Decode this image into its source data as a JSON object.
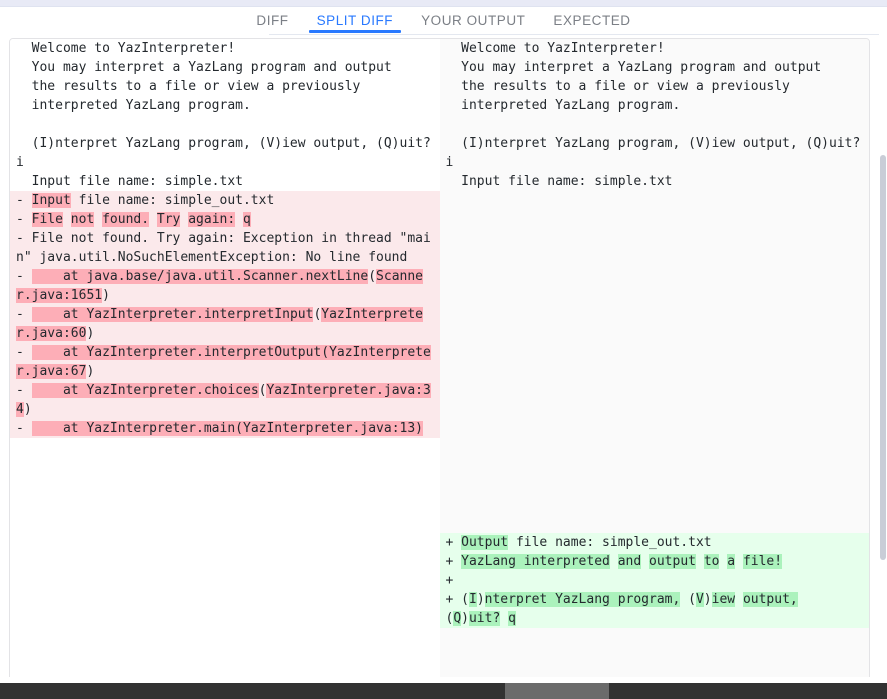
{
  "tabs": [
    {
      "label": "DIFF",
      "active": false
    },
    {
      "label": "SPLIT DIFF",
      "active": true
    },
    {
      "label": "YOUR OUTPUT",
      "active": false
    },
    {
      "label": "EXPECTED",
      "active": false
    }
  ],
  "colors": {
    "accent": "#2979ff",
    "tab_inactive": "#7b7f86",
    "del_line_bg": "#fbe9eb",
    "del_word_bg": "#fdaeb7",
    "add_line_bg": "#e6ffec",
    "add_word_bg": "#abf2bc",
    "text": "#24292e",
    "right_pane_bg": "#fafafa",
    "scrollbar_track": "#323232",
    "scrollbar_thumb": "#6b6b6b"
  },
  "left_pane": {
    "name": "your-output",
    "lines": [
      {
        "type": "ctx",
        "sign": "  ",
        "parts": [
          {
            "t": "Welcome to YazInterpreter!",
            "hl": false
          }
        ]
      },
      {
        "type": "ctx",
        "sign": "  ",
        "parts": [
          {
            "t": "You may interpret a YazLang program and output",
            "hl": false
          }
        ]
      },
      {
        "type": "ctx",
        "sign": "  ",
        "parts": [
          {
            "t": "the results to a file or view a previously",
            "hl": false
          }
        ]
      },
      {
        "type": "ctx",
        "sign": "  ",
        "parts": [
          {
            "t": "interpreted YazLang program.",
            "hl": false
          }
        ]
      },
      {
        "type": "ctx",
        "sign": "  ",
        "parts": [
          {
            "t": "",
            "hl": false
          }
        ]
      },
      {
        "type": "ctx",
        "sign": "  ",
        "parts": [
          {
            "t": "(I)nterpret YazLang program, (V)iew output, (Q)uit? i",
            "hl": false
          }
        ]
      },
      {
        "type": "ctx",
        "sign": "  ",
        "parts": [
          {
            "t": "Input file name: simple.txt",
            "hl": false
          }
        ]
      },
      {
        "type": "del",
        "sign": "- ",
        "parts": [
          {
            "t": "Input",
            "hl": true
          },
          {
            "t": " file name: simple_out.txt",
            "hl": false
          }
        ]
      },
      {
        "type": "del",
        "sign": "- ",
        "parts": [
          {
            "t": "File",
            "hl": true
          },
          {
            "t": " ",
            "hl": false
          },
          {
            "t": "not",
            "hl": true
          },
          {
            "t": " ",
            "hl": false
          },
          {
            "t": "found.",
            "hl": true
          },
          {
            "t": " ",
            "hl": false
          },
          {
            "t": "Try",
            "hl": true
          },
          {
            "t": " ",
            "hl": false
          },
          {
            "t": "again:",
            "hl": true
          },
          {
            "t": " ",
            "hl": false
          },
          {
            "t": "q",
            "hl": true
          }
        ]
      },
      {
        "type": "del",
        "sign": "- ",
        "parts": [
          {
            "t": "File not found. Try again: Exception in thread \"main\" java.util.NoSuchElementException: No line found",
            "hl": false
          }
        ]
      },
      {
        "type": "del",
        "sign": "- ",
        "parts": [
          {
            "t": "    at ",
            "hl": true
          },
          {
            "t": "java.base/java.util.Scanner.nextLine",
            "hl": true
          },
          {
            "t": "(",
            "hl": false
          },
          {
            "t": "Scanner.java:1651",
            "hl": true
          },
          {
            "t": ")",
            "hl": false
          }
        ]
      },
      {
        "type": "del",
        "sign": "- ",
        "parts": [
          {
            "t": "    at ",
            "hl": true
          },
          {
            "t": "YazInterpreter.interpretInput",
            "hl": true
          },
          {
            "t": "(",
            "hl": false
          },
          {
            "t": "YazInterpreter.java:60",
            "hl": true
          },
          {
            "t": ")",
            "hl": false
          }
        ]
      },
      {
        "type": "del",
        "sign": "- ",
        "parts": [
          {
            "t": "    at ",
            "hl": true
          },
          {
            "t": "YazInterpreter.interpretOutput(YazInterpreter.java:67",
            "hl": true
          },
          {
            "t": ")",
            "hl": false
          }
        ]
      },
      {
        "type": "del",
        "sign": "- ",
        "parts": [
          {
            "t": "    at ",
            "hl": true
          },
          {
            "t": "YazInterpreter.choices",
            "hl": true
          },
          {
            "t": "(",
            "hl": false
          },
          {
            "t": "YazInterpreter.java:34",
            "hl": true
          },
          {
            "t": ")",
            "hl": false
          }
        ]
      },
      {
        "type": "del",
        "sign": "- ",
        "parts": [
          {
            "t": "    at ",
            "hl": true
          },
          {
            "t": "YazInterpreter.main(YazInterpreter.java:13)",
            "hl": true
          }
        ]
      }
    ]
  },
  "right_pane": {
    "name": "expected-output",
    "lines": [
      {
        "type": "ctx",
        "sign": "  ",
        "parts": [
          {
            "t": "Welcome to YazInterpreter!",
            "hl": false
          }
        ]
      },
      {
        "type": "ctx",
        "sign": "  ",
        "parts": [
          {
            "t": "You may interpret a YazLang program and output",
            "hl": false
          }
        ]
      },
      {
        "type": "ctx",
        "sign": "  ",
        "parts": [
          {
            "t": "the results to a file or view a previously",
            "hl": false
          }
        ]
      },
      {
        "type": "ctx",
        "sign": "  ",
        "parts": [
          {
            "t": "interpreted YazLang program.",
            "hl": false
          }
        ]
      },
      {
        "type": "ctx",
        "sign": "  ",
        "parts": [
          {
            "t": "",
            "hl": false
          }
        ]
      },
      {
        "type": "ctx",
        "sign": "  ",
        "parts": [
          {
            "t": "(I)nterpret YazLang program, (V)iew output, (Q)uit? i",
            "hl": false
          }
        ]
      },
      {
        "type": "ctx",
        "sign": "  ",
        "parts": [
          {
            "t": "Input file name: simple.txt",
            "hl": false
          }
        ]
      }
    ],
    "additions": [
      {
        "type": "add",
        "sign": "+ ",
        "parts": [
          {
            "t": "Output",
            "hl": true
          },
          {
            "t": " file name: simple_out.txt",
            "hl": false
          }
        ]
      },
      {
        "type": "add",
        "sign": "+ ",
        "parts": [
          {
            "t": "YazLang interpreted",
            "hl": true
          },
          {
            "t": " ",
            "hl": false
          },
          {
            "t": "and",
            "hl": true
          },
          {
            "t": " ",
            "hl": false
          },
          {
            "t": "output",
            "hl": true
          },
          {
            "t": " ",
            "hl": false
          },
          {
            "t": "to",
            "hl": true
          },
          {
            "t": " ",
            "hl": false
          },
          {
            "t": "a",
            "hl": true
          },
          {
            "t": " ",
            "hl": false
          },
          {
            "t": "file!",
            "hl": true
          }
        ]
      },
      {
        "type": "add",
        "sign": "+",
        "parts": [
          {
            "t": "",
            "hl": false
          }
        ]
      },
      {
        "type": "add",
        "sign": "+ ",
        "parts": [
          {
            "t": "(",
            "hl": false
          },
          {
            "t": "I",
            "hl": true
          },
          {
            "t": ")",
            "hl": false
          },
          {
            "t": "nterpret YazLang program,",
            "hl": true
          },
          {
            "t": " (",
            "hl": false
          },
          {
            "t": "V",
            "hl": true
          },
          {
            "t": ")",
            "hl": false
          },
          {
            "t": "iew",
            "hl": true
          },
          {
            "t": " ",
            "hl": false
          },
          {
            "t": "output,",
            "hl": true
          },
          {
            "t": "\n(",
            "hl": false
          },
          {
            "t": "Q",
            "hl": true
          },
          {
            "t": ")",
            "hl": false
          },
          {
            "t": "uit?",
            "hl": true
          },
          {
            "t": " ",
            "hl": false
          },
          {
            "t": "q",
            "hl": true
          }
        ]
      }
    ]
  },
  "scrollbars": {
    "vertical_name": "vertical-scrollbar",
    "horizontal_name": "horizontal-scrollbar"
  }
}
